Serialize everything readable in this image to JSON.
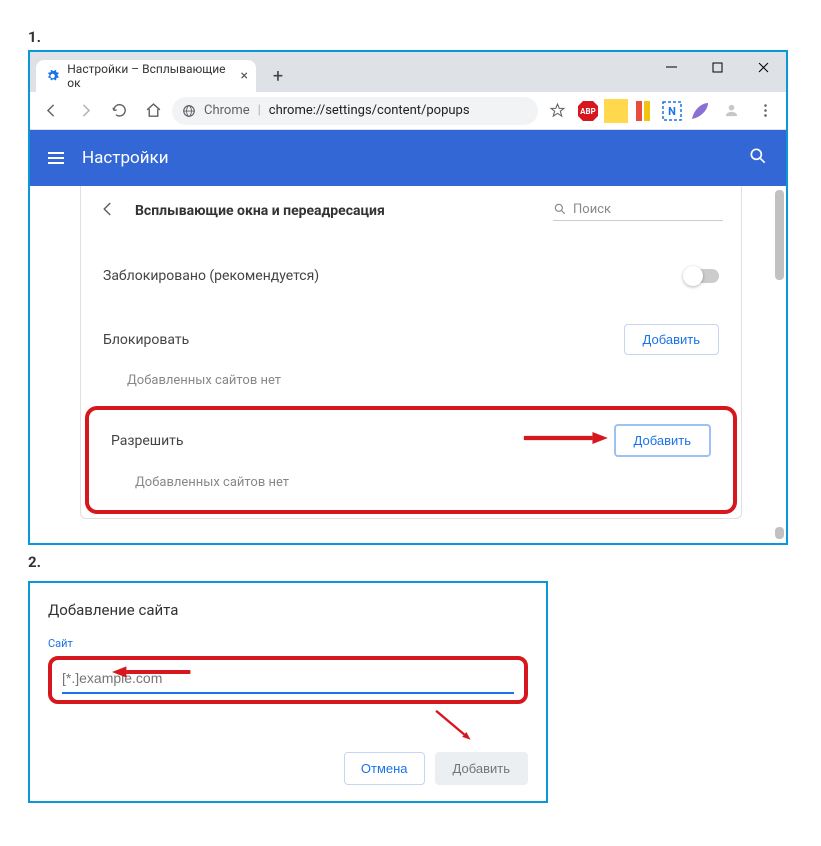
{
  "steps": {
    "one": "1.",
    "two": "2."
  },
  "window": {
    "tab_title": "Настройки – Всплывающие ок",
    "chrome_label": "Chrome",
    "url_path": "chrome://settings/content/popups"
  },
  "header": {
    "title": "Настройки"
  },
  "page": {
    "section_title": "Всплывающие окна и переадресация",
    "search_placeholder": "Поиск",
    "blocked_label": "Заблокировано (рекомендуется)",
    "block_section": "Блокировать",
    "block_add": "Добавить",
    "block_empty": "Добавленных сайтов нет",
    "allow_section": "Разрешить",
    "allow_add": "Добавить",
    "allow_empty": "Добавленных сайтов нет"
  },
  "dialog": {
    "title": "Добавление сайта",
    "site_label": "Сайт",
    "placeholder": "[*.]example.com",
    "cancel": "Отмена",
    "add": "Добавить"
  }
}
